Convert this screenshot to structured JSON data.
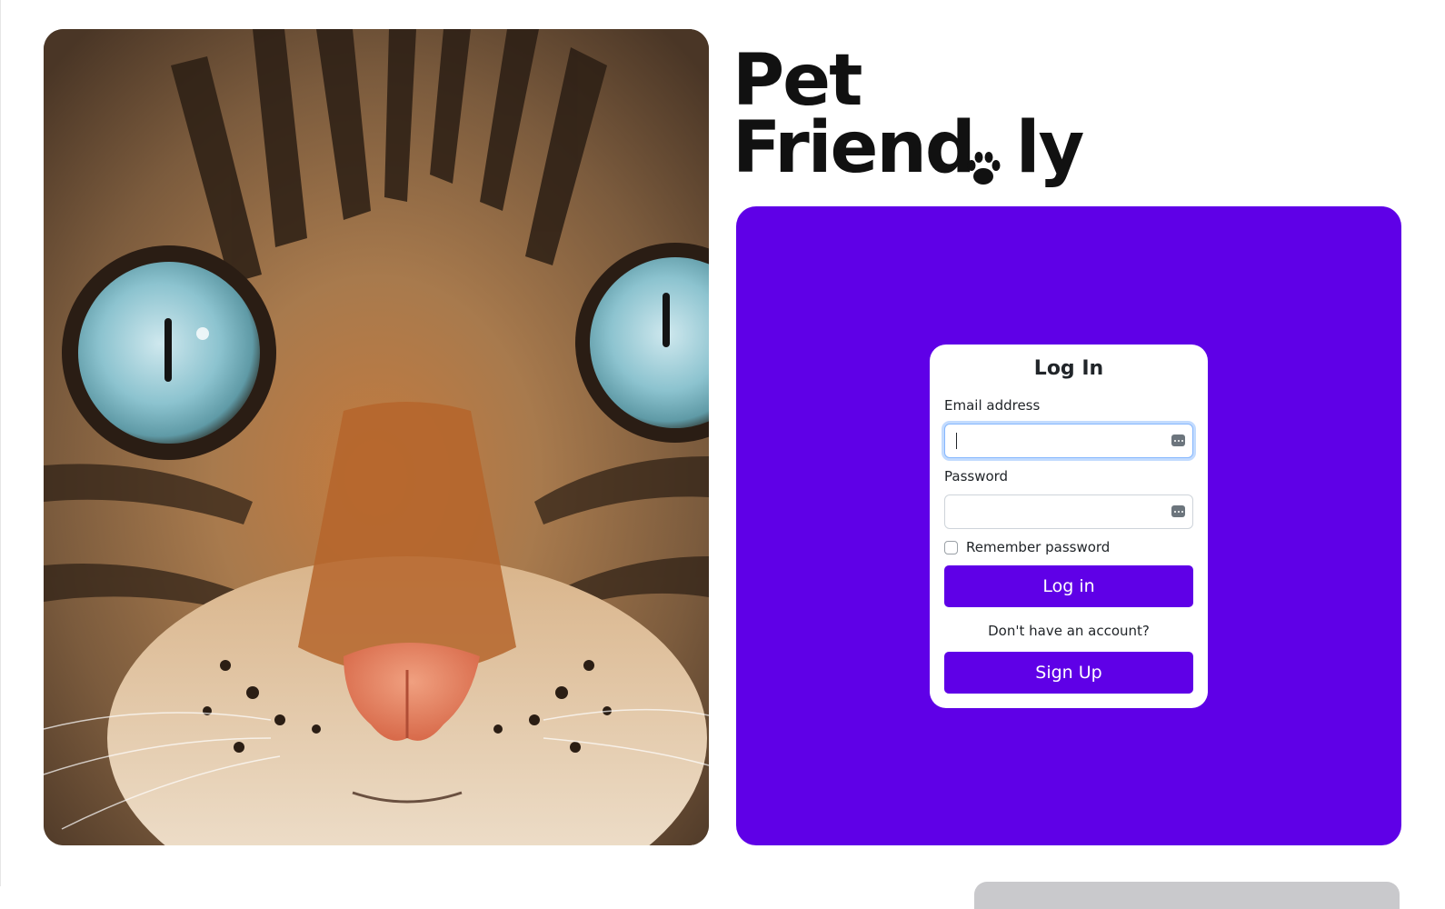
{
  "brand": {
    "line1": "Pet",
    "line2": "Friend",
    "line2_suffix": "ly",
    "paw_icon": "paw-icon"
  },
  "hero_image": {
    "subject": "cat-face-photo"
  },
  "login": {
    "title": "Log In",
    "email_label": "Email address",
    "email_value": "",
    "password_label": "Password",
    "password_value": "",
    "remember_label": "Remember password",
    "remember_checked": false,
    "login_button": "Log in",
    "no_account_text": "Don't have an account?",
    "signup_button": "Sign Up"
  },
  "colors": {
    "brand_purple": "#5f00e7",
    "logo_text": "#111111",
    "card_bg": "#ffffff",
    "focus_ring": "#86b7fe"
  }
}
